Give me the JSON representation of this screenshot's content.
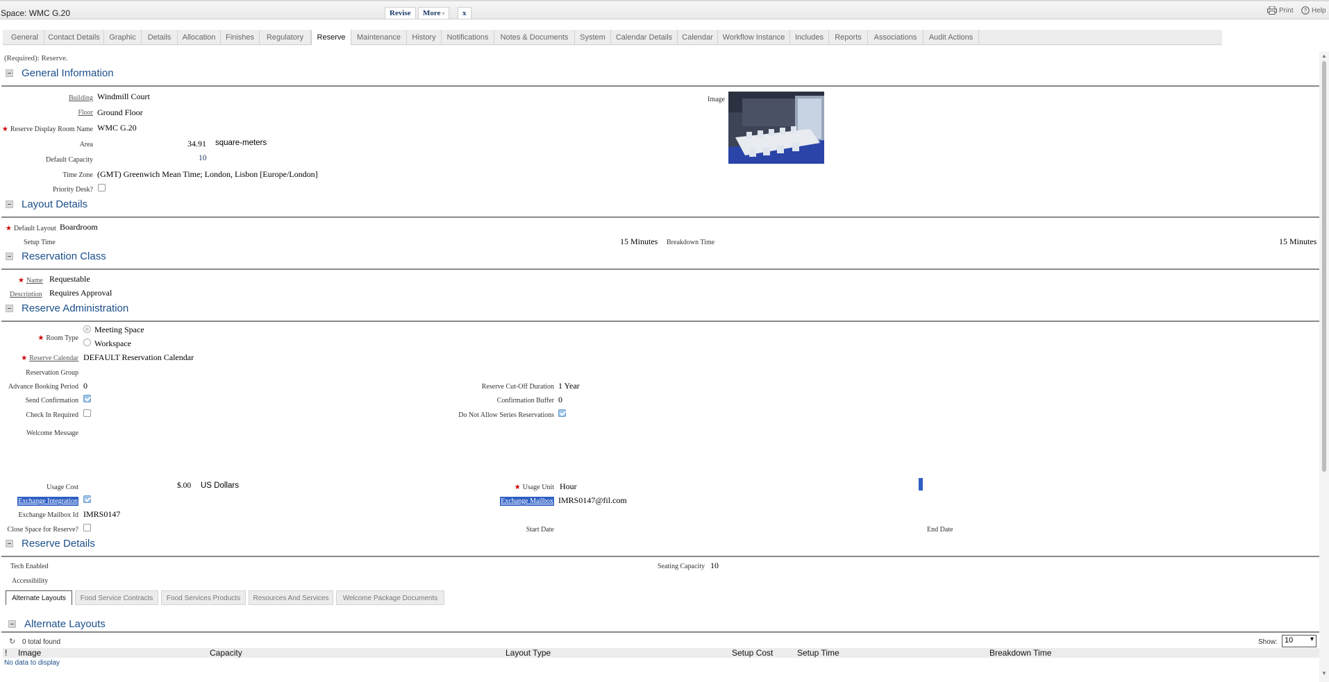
{
  "window": {
    "title": "Space: WMC G.20",
    "revise": "Revise",
    "more": "More",
    "close": "x",
    "print": "Print",
    "help": "Help"
  },
  "tabs": [
    "General",
    "Contact Details",
    "Graphic",
    "Details",
    "Allocation",
    "Finishes",
    "Regulatory",
    "Reserve",
    "Maintenance",
    "History",
    "Notifications",
    "Notes & Documents",
    "System",
    "Calendar Details",
    "Calendar",
    "Workflow Instance",
    "Includes",
    "Reports",
    "Associations",
    "Audit Actions"
  ],
  "active_tab": "Reserve",
  "required_note": "(Required): Reserve.",
  "general": {
    "header": "General Information",
    "building_label": "Building",
    "building": "Windmill Court",
    "floor_label": "Floor",
    "floor": "Ground Floor",
    "display_name_label": "Reserve Display Room Name",
    "display_name": "WMC G.20",
    "area_label": "Area",
    "area": "34.91",
    "area_unit": "square-meters",
    "capacity_label": "Default Capacity",
    "capacity": "10",
    "timezone_label": "Time Zone",
    "timezone": "(GMT) Greenwich Mean Time; London, Lisbon [Europe/London]",
    "priority_label": "Priority Desk?",
    "image_label": "Image"
  },
  "layout": {
    "header": "Layout Details",
    "default_layout_label": "Default Layout",
    "default_layout": "Boardroom",
    "setup_label": "Setup Time",
    "setup": "15 Minutes",
    "breakdown_label": "Breakdown Time",
    "breakdown": "15 Minutes"
  },
  "resclass": {
    "header": "Reservation Class",
    "name_label": "Name",
    "name": "Requestable",
    "desc_label": "Description",
    "desc": "Requires Approval"
  },
  "admin": {
    "header": "Reserve Administration",
    "room_type_label": "Room Type",
    "opt1": "Meeting Space",
    "opt2": "Workspace",
    "calendar_label": "Reserve Calendar",
    "calendar": "DEFAULT Reservation Calendar",
    "group_label": "Reservation Group",
    "advance_label": "Advance Booking Period",
    "advance": "0",
    "cutoff_label": "Reserve Cut-Off Duration",
    "cutoff": "1 Year",
    "send_conf_label": "Send Confirmation",
    "conf_buffer_label": "Confirmation Buffer",
    "conf_buffer": "0",
    "checkin_label": "Check In Required",
    "noseries_label": "Do Not Allow Series Reservations",
    "welcome_label": "Welcome Message",
    "usage_cost_label": "Usage Cost",
    "usage_cost": "$.00",
    "currency": "US Dollars",
    "usage_unit_label": "Usage Unit",
    "usage_unit": "Hour",
    "exch_int_label": "Exchange Integration",
    "exch_mailbox_label": "Exchange Mailbox",
    "exch_mailbox": "IMRS0147@fil.com",
    "mailbox_id_label": "Exchange Mailbox Id",
    "mailbox_id": "IMRS0147",
    "close_label": "Close Space for Reserve?",
    "start_label": "Start Date",
    "end_label": "End Date"
  },
  "details": {
    "header": "Reserve Details",
    "tech_label": "Tech Enabled",
    "seating_label": "Seating Capacity",
    "seating": "10",
    "access_label": "Accessibility"
  },
  "subtabs": [
    "Alternate Layouts",
    "Food Service Contracts",
    "Food Services Products",
    "Resources And Services",
    "Welcome Package Documents"
  ],
  "alt": {
    "header": "Alternate Layouts",
    "total": "0 total found",
    "show_label": "Show:",
    "show_value": "10",
    "cols": [
      "!",
      "Image",
      "Capacity",
      "Layout Type",
      "Setup Cost",
      "Setup Time",
      "Breakdown Time"
    ],
    "empty": "No data to display"
  }
}
